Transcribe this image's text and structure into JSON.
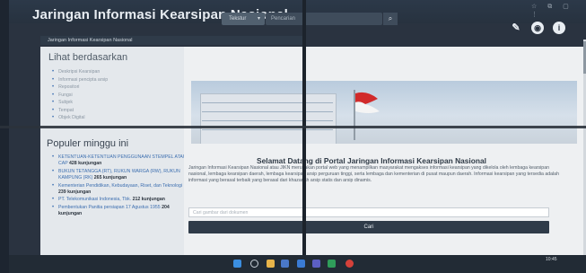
{
  "header": {
    "site_title": "Jaringan Informasi Kearsipan Nasional",
    "category_select": "Tekstur",
    "search_placeholder": "Pencarian",
    "search_icon": "search-icon",
    "icons": [
      "wrench-icon",
      "compass-icon",
      "info-icon"
    ]
  },
  "breadcrumb": "Jaringan Informasi Kearsipan Nasional",
  "lihat": {
    "title": "Lihat berdasarkan",
    "items": [
      "Deskripsi Kearsipan",
      "Informasi pencipta arsip",
      "Repositori",
      "Fungsi",
      "Subjek",
      "Tempat",
      "Objek Digital"
    ]
  },
  "populer": {
    "title": "Populer minggu ini",
    "items": [
      {
        "text": "KETENTUAN-KETENTUAN PENGGUNAAN STEMPEL ATAU CAP",
        "visits": "428 kunjungan"
      },
      {
        "text": "BUKUN TETANGGA (RT), RUKUN WARGA (RW), RUKUN KAMPUNG (RK)",
        "visits": "265 kunjungan"
      },
      {
        "text": "Kementerian Pendidikan, Kebudayaan, Riset, dan Teknologi",
        "visits": "239 kunjungan"
      },
      {
        "text": "PT. Telekomunikasi Indonesia, Tbk.",
        "visits": "212 kunjungan"
      },
      {
        "text": "Pembentukan Panitia persiapan 17 Agustus 1955",
        "visits": "204 kunjungan"
      }
    ]
  },
  "main": {
    "welcome_title": "Selamat Datang di Portal Jaringan Informasi Kearsipan Nasional",
    "intro": "Jaringan Informasi Kearsipan Nasional atau JIKN merupakan portal web yang menampilkan masyarakat mengakses informasi kearsipan yang dikelola oleh lembaga kearsipan nasional, lembaga kearsipan daerah, lembaga kearsipan arsip perguruan tinggi, serta lembaga dan kementerian di pusat maupun daerah. Informasi kearsipan yang tersedia adalah informasi yang berasal terbaik yang berasal dari khazanah arsip statis dan arsip dinamis.",
    "image_search_placeholder": "Cari gambar dari dokumen",
    "cari_button": "Cari"
  },
  "taskbar": {
    "time": "10:45",
    "date": "",
    "icons": [
      "windows-icon",
      "search-icon",
      "file-explorer-icon",
      "folder-icon",
      "mail-icon",
      "teams-icon",
      "chrome-icon"
    ]
  },
  "colors": {
    "header_bg": "#2c3949",
    "link_blue": "#3d6fb0",
    "button_dark": "#2f3b49"
  }
}
